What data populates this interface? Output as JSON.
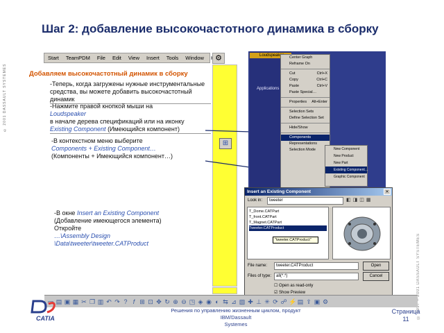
{
  "left_band_text": "© 2001 DASSAULT SYSTEMES",
  "side_copyright": "© 1997 – 2001 DASSAULT SYSTEMES",
  "title": "Шаг 2: добавление высокочастотного динамика в сборку",
  "menubar": {
    "items": [
      "Start",
      "TeamPDM",
      "File",
      "Edit",
      "View",
      "Insert",
      "Tools",
      "Window",
      "Help"
    ]
  },
  "step_heading": "Добавляем высокочастотный динамик в сборку",
  "para1": "-Теперь, когда загружены нужные инструментальные средства, вы можете добавить высокочастотный динамик",
  "para2": {
    "line1": "-Нажмите правой кнопкой мыши на",
    "link": "Loudspeaker",
    "line2": "в начале дерева спецификаций или на иконку",
    "link2": "Existing Component",
    "line3": "(Имеющийся компонент)"
  },
  "para3": {
    "line1": "-В контекстном меню выберите",
    "link": "Components + Existing Component…",
    "line2": "(Компоненты + Имеющийся компонент…)"
  },
  "para4": {
    "line1": "-В окне",
    "link": "Insert an Existing Component",
    "line2": "(Добавление имеющегося элемента)",
    "line3": "Откройте",
    "path1": "…\\Assembly Design",
    "path2": "\\Data\\tweeter\\tweeter.CATProduct"
  },
  "context_menu": {
    "tree_items": [
      "Loudspeaker",
      "Applications"
    ],
    "items": [
      "Center Graph",
      "Reframe On",
      "Cut",
      "Copy",
      "Paste",
      "Paste Special…",
      "Properties",
      "Selection Sets",
      "Define Selection Set",
      "Hide/Show",
      "Components",
      "Representations",
      "Selection Mode"
    ],
    "shortcuts": [
      "",
      "",
      "Ctrl+X",
      "Ctrl+C",
      "Ctrl+V",
      "",
      "Alt+Enter",
      "",
      "",
      "",
      "",
      "",
      ""
    ],
    "sub_items": [
      "New Component",
      "New Product",
      "New Part",
      "Existing Component…",
      "Graphic Component"
    ]
  },
  "dialog": {
    "title": "Insert an Existing Component",
    "look_in_label": "Look in:",
    "look_in_value": "tweeter",
    "files": [
      "T_Dome.CATPart",
      "T_front.CATPart",
      "T_Magnet.CATPart",
      "Tweeter.CATProduct"
    ],
    "tooltip": "\"tweeter.CATProduct\"",
    "file_name_label": "File name:",
    "file_name_value": "tweeter.CATProduct",
    "file_type_label": "Files of type:",
    "file_type_value": "all(*.*)",
    "open_readonly": "Open as read-only",
    "show_preview": "Show Preview",
    "open_btn": "Open",
    "cancel_btn": "Cancel"
  },
  "toolbar_icons": [
    "new",
    "open",
    "save",
    "print",
    "cut",
    "copy",
    "paste",
    "undo",
    "redo",
    "help",
    "fx",
    "tree",
    "fit",
    "pan",
    "rotate",
    "zoom-in",
    "zoom-out",
    "normal",
    "views",
    "render",
    "hide",
    "swap"
  ],
  "footer": {
    "logo": "CATIA",
    "text_line1": "Решения по управлению жизненным циклом, продукт IBM/Dassault",
    "text_line2": "Systemes",
    "page_label": "Страница",
    "page_num": "11"
  },
  "colors": {
    "title": "#1a2c6b",
    "heading": "#d35400",
    "link": "#2a4faf",
    "slider": "#ffff33",
    "selection": "#0a246a"
  }
}
